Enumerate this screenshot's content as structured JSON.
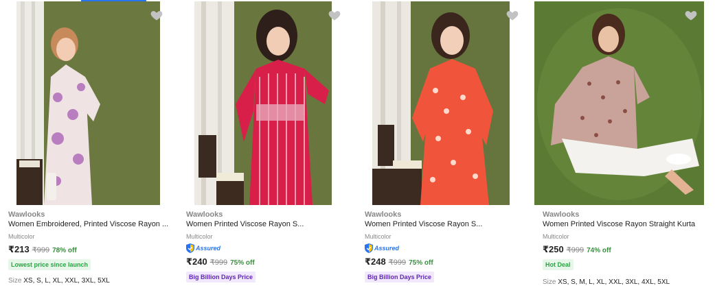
{
  "products": [
    {
      "brand": "Wawlooks",
      "title": "Women Embroidered, Printed Viscose Rayon ...",
      "color": "Multicolor",
      "price": "₹213",
      "mrp": "₹999",
      "discount": "78% off",
      "assured": false,
      "tag": "Lowest price since launch",
      "tag_color": "#26a541",
      "size_label": "Size",
      "sizes": "XS, S, L, XL, XXL, 3XL, 5XL",
      "kurta_color": "#efe3e3",
      "print_color": "#b87ec0",
      "background": "#6b7940",
      "wishlisted": false
    },
    {
      "brand": "Wawlooks",
      "title": "Women Printed Viscose Rayon S...",
      "color": "Multicolor",
      "assured": true,
      "assured_label": "Assured",
      "price": "₹240",
      "mrp": "₹999",
      "discount": "75% off",
      "tag": "Big Billion Days Price",
      "tag_color": "#5f24b6",
      "kurta_color": "#d81f4a",
      "print_color": "#f7d1da",
      "background": "#69773e",
      "wishlisted": false
    },
    {
      "brand": "Wawlooks",
      "title": "Women Printed Viscose Rayon S...",
      "color": "Multicolor",
      "assured": true,
      "assured_label": "Assured",
      "price": "₹248",
      "mrp": "₹999",
      "discount": "75% off",
      "tag": "Big Billion Days Price",
      "tag_color": "#5f24b6",
      "kurta_color": "#f0553b",
      "print_color": "#ffd9cc",
      "background": "#66753d",
      "wishlisted": false
    },
    {
      "brand": "Wawlooks",
      "title": "Women Printed Viscose Rayon Straight Kurta",
      "color": "Multicolor",
      "price": "₹250",
      "mrp": "₹999",
      "discount": "74% off",
      "assured": false,
      "tag": "Hot Deal",
      "tag_color": "#26a541",
      "size_label": "Size",
      "sizes": "XS, S, M, L, XL, XXL, 3XL, 4XL, 5XL",
      "kurta_color": "#c9a39a",
      "print_color": "#8b4e44",
      "background": "#5b7a34",
      "wishlisted": false
    }
  ],
  "icons": {
    "wishlist": "heart-icon",
    "assured": "shield-check-icon"
  },
  "colors": {
    "accent": "#2874f0",
    "discount": "#388e3c",
    "muted_text": "#878787"
  }
}
